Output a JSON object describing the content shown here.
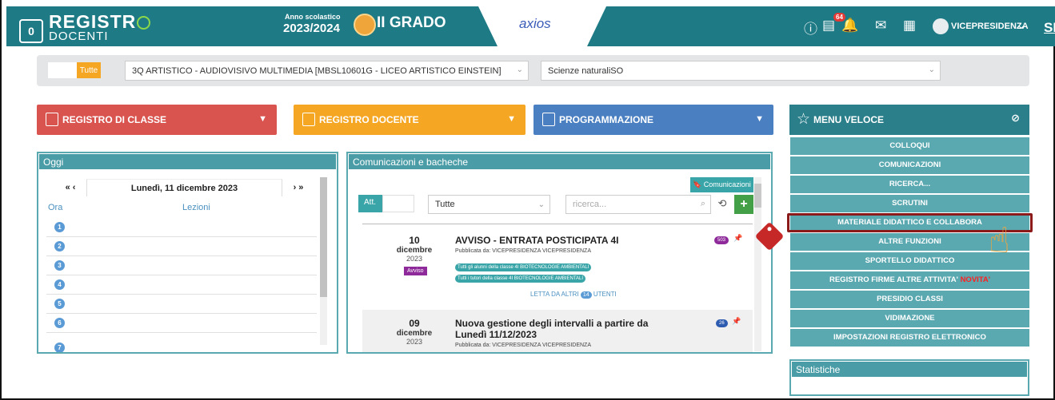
{
  "header": {
    "logo_text": "0",
    "brand_line1": "REGISTR",
    "brand_line2": "DOCENTI",
    "year_label": "Anno scolastico",
    "year_value": "2023/2024",
    "grade": "II GRADO",
    "axios": "axios",
    "notifications": "64",
    "user": "VICEPRESIDENZA",
    "initials": "SD",
    "colors": {
      "topbar": "#1e7a85",
      "accent": "#8bd84b"
    }
  },
  "filters": {
    "tutte_label": "Tutte",
    "class_select": "3Q ARTISTICO - AUDIOVISIVO MULTIMEDIA [MBSL10601G - LICEO ARTISTICO EINSTEIN]",
    "subject_select": "Scienze naturaliSO"
  },
  "buttons": {
    "registro_classe": "REGISTRO DI CLASSE",
    "registro_docente": "REGISTRO DOCENTE",
    "programmazione": "PROGRAMMAZIONE",
    "colors": {
      "classe": "#d9534f",
      "docente": "#f5a623",
      "programmazione": "#4a7fc1"
    }
  },
  "oggi": {
    "title": "Oggi",
    "date": "Lunedì, 11 dicembre 2023",
    "col_ora": "Ora",
    "col_lezioni": "Lezioni",
    "hours": [
      "1",
      "2",
      "3",
      "4",
      "5",
      "6",
      "7"
    ]
  },
  "comunicazioni": {
    "title": "Comunicazioni e bacheche",
    "comm_button": "Comunicazioni",
    "att_label": "Att.",
    "filter_value": "Tutte",
    "search_placeholder": "ricerca...",
    "posts": [
      {
        "day": "10",
        "month": "dicembre",
        "year": "2023",
        "category": "Avviso",
        "title": "AVVISO - ENTRATA POSTICIPATA 4I",
        "published_by": "Pubblicata da: VICEPRESIDENZA VICEPRESIDENZA",
        "tags": [
          "Tutti gli alunni della classe 4I BIOTECNOLOGIE AMBIENTALI",
          "Tutti i tutori della classe 4I BIOTECNOLOGIE AMBIENTALI"
        ],
        "count": "503",
        "read_label": "LETTA DA ALTRI",
        "read_count": "14",
        "read_suffix": "UTENTI"
      },
      {
        "day": "09",
        "month": "dicembre",
        "year": "2023",
        "title_line1": "Nuova gestione degli intervalli a partire da",
        "title_line2": "Lunedì 11/12/2023",
        "published_by": "Pubblicata da: VICEPRESIDENZA VICEPRESIDENZA",
        "count": "26"
      }
    ]
  },
  "menu_veloce": {
    "title": "MENU VELOCE",
    "items": [
      "COLLOQUI",
      "COMUNICAZIONI",
      "RICERCA...",
      "SCRUTINI",
      "MATERIALE DIDATTICO E COLLABORA",
      "ALTRE FUNZIONI",
      "SPORTELLO DIDATTICO",
      "REGISTRO FIRME ALTRE ATTIVITA'",
      "PRESIDIO CLASSI",
      "VIDIMAZIONE",
      "IMPOSTAZIONI REGISTRO ELETTRONICO"
    ],
    "novita": "NOVITA'",
    "statistiche": "Statistiche"
  }
}
